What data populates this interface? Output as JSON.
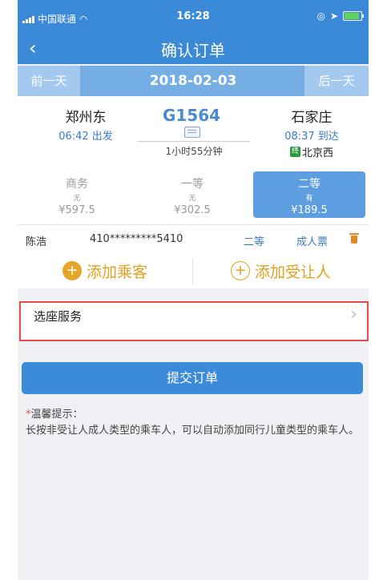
{
  "status_bar": {
    "carrier": "中国联通",
    "time": "16:28"
  },
  "navbar": {
    "title": "确认订单"
  },
  "date_bar": {
    "prev_label": "前一天",
    "date": "2018-02-03",
    "next_label": "后一天"
  },
  "train": {
    "number": "G1564",
    "duration": "1小时55分钟",
    "from": {
      "station": "郑州东",
      "time_label": "06:42 出发"
    },
    "to": {
      "station": "石家庄",
      "time_label": "08:37 到达",
      "via_tag": "终",
      "via": "北京西"
    }
  },
  "seats": [
    {
      "class": "商务",
      "availability": "无",
      "price": "¥597.5",
      "selected": false
    },
    {
      "class": "一等",
      "availability": "无",
      "price": "¥302.5",
      "selected": false
    },
    {
      "class": "二等",
      "availability": "有",
      "price": "¥189.5",
      "selected": true
    }
  ],
  "passenger": {
    "name": "陈浩",
    "id_number": "410*********5410",
    "seat_class": "二等",
    "ticket_type": "成人票"
  },
  "actions": {
    "add_passenger": "添加乘客",
    "add_beneficiary": "添加受让人"
  },
  "seat_service": {
    "label": "选座服务"
  },
  "submit_label": "提交订单",
  "tips": {
    "title": "温馨提示：",
    "body": "长按非受让人成人类型的乘车人，可以自动添加同行儿童类型的乘车人。"
  },
  "colors": {
    "accent": "#3a8ad8",
    "warning": "#e0a020",
    "highlight_border": "#e04a4a"
  }
}
